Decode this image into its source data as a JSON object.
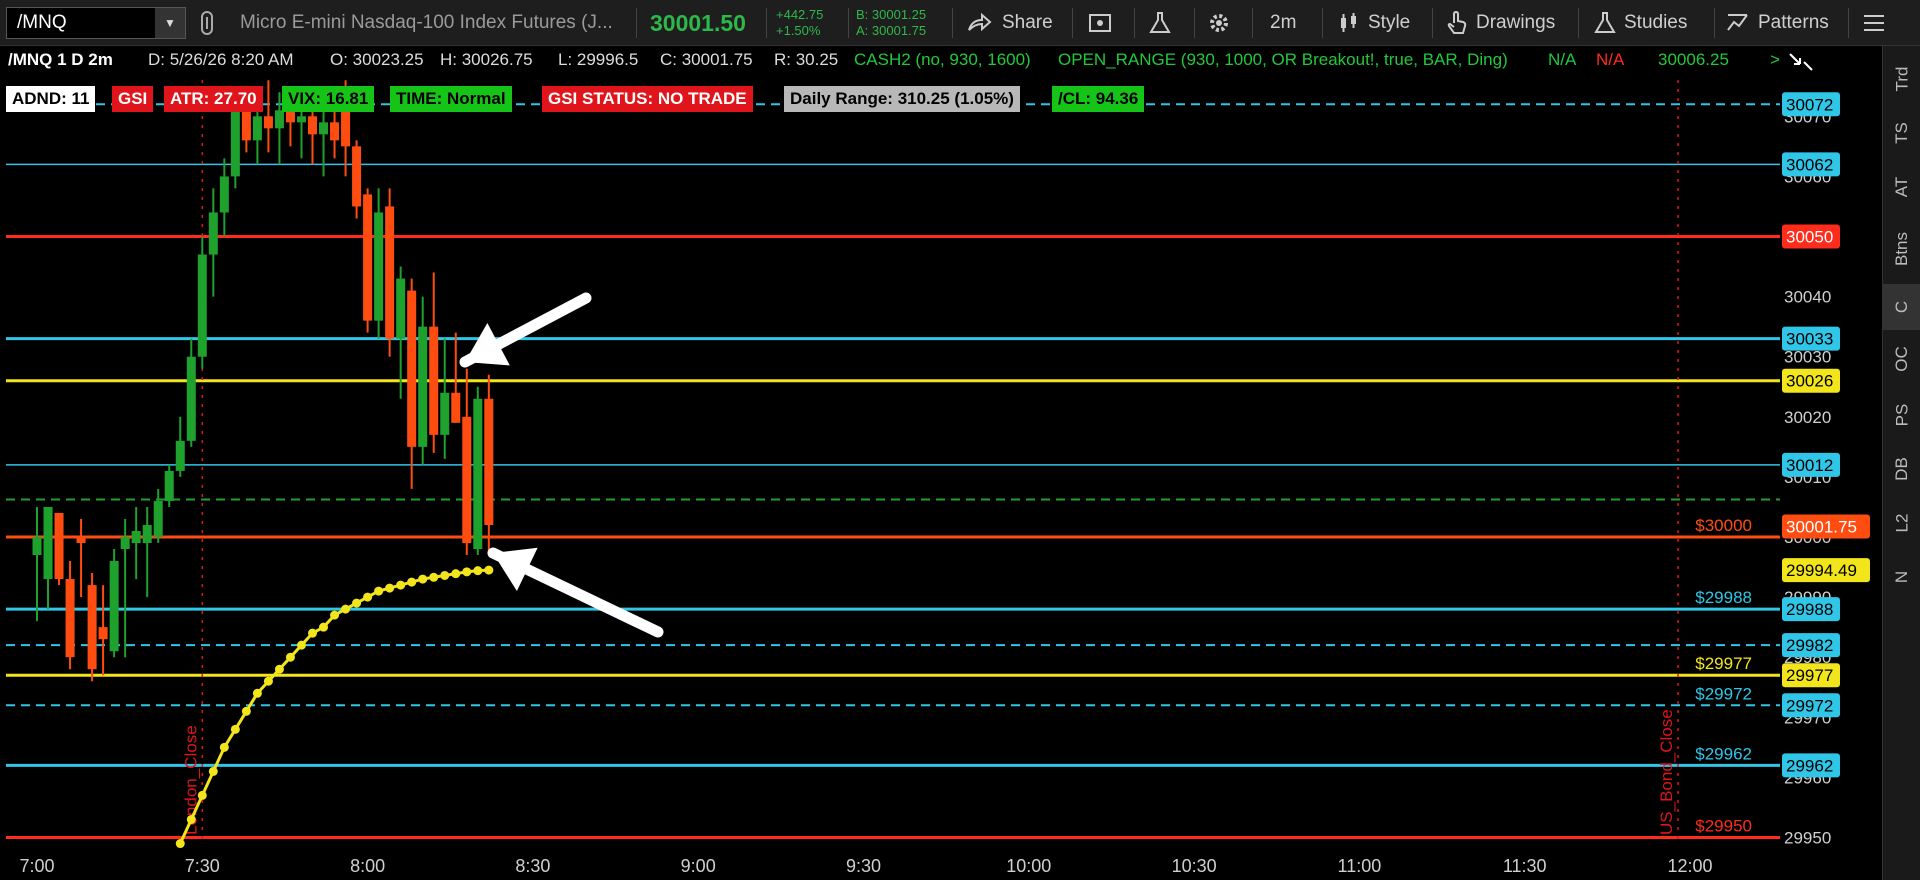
{
  "toolbar": {
    "symbol": "/MNQ",
    "description": "Micro E-mini Nasdaq-100 Index Futures (J...",
    "last_price": "30001.50",
    "net_change": "+442.75",
    "pct_change": "+1.50%",
    "bid": "B: 30001.25",
    "ask": "A: 30001.75",
    "share": "Share",
    "timeframe": "2m",
    "style": "Style",
    "drawings": "Drawings",
    "studies": "Studies",
    "patterns": "Patterns"
  },
  "infobar": {
    "title": "/MNQ 1 D 2m",
    "date": "D: 5/26/26 8:20 AM",
    "open": "O: 30023.25",
    "high": "H: 30026.75",
    "low": "L: 29996.5",
    "close": "C: 30001.75",
    "range": "R: 30.25",
    "cash2": "CASH2 (no, 930, 1600)",
    "open_range": "OPEN_RANGE (930, 1000, OR Breakout!, true, BAR, Ding)",
    "na1": "N/A",
    "na2": "N/A",
    "value": "30006.25"
  },
  "labels": {
    "adnd": "ADND: 11",
    "gsi": "GSI",
    "atr": "ATR: 27.70",
    "vix": "VIX: 16.81",
    "time": "TIME: Normal",
    "gsi_status": "GSI STATUS: NO TRADE",
    "daily_range": "Daily Range: 310.25 (1.05%)",
    "cl": "/CL: 94.36"
  },
  "colors": {
    "up": "#1fa12e",
    "down": "#ff4d12",
    "cyan": "#2fc6e8",
    "red": "#ff2b1b",
    "yellow": "#f2e51c",
    "green": "#1fa12e",
    "orange": "#ff4d12"
  },
  "chart_data": {
    "type": "candlestick",
    "x_axis": [
      "7:00",
      "7:30",
      "8:00",
      "8:30",
      "9:00",
      "9:30",
      "10:00",
      "10:30",
      "11:00",
      "11:30",
      "12:00"
    ],
    "y_axis": [
      "30070",
      "30060",
      "30050",
      "30040",
      "30030",
      "30020",
      "30010",
      "30000",
      "29990",
      "29980",
      "29970",
      "29960",
      "29950"
    ],
    "ylim": [
      29949,
      30076
    ],
    "candles": [
      {
        "t": "7:00",
        "o": 29997,
        "h": 30005,
        "l": 29986,
        "c": 30000
      },
      {
        "t": "7:02",
        "o": 29993,
        "h": 30005,
        "l": 29988,
        "c": 30005
      },
      {
        "t": "7:04",
        "o": 30004,
        "h": 30004,
        "l": 29992,
        "c": 29993
      },
      {
        "t": "7:06",
        "o": 29993,
        "h": 29996,
        "l": 29978,
        "c": 29980
      },
      {
        "t": "7:08",
        "o": 30000,
        "h": 30003,
        "l": 29990,
        "c": 29999
      },
      {
        "t": "7:10",
        "o": 29992,
        "h": 29994,
        "l": 29976,
        "c": 29978
      },
      {
        "t": "7:12",
        "o": 29985,
        "h": 29992,
        "l": 29977,
        "c": 29983
      },
      {
        "t": "7:14",
        "o": 29981,
        "h": 29998,
        "l": 29980,
        "c": 29996
      },
      {
        "t": "7:16",
        "o": 29998,
        "h": 30003,
        "l": 29980,
        "c": 30000
      },
      {
        "t": "7:18",
        "o": 29999,
        "h": 30005,
        "l": 29993,
        "c": 30001
      },
      {
        "t": "7:20",
        "o": 29999,
        "h": 30005,
        "l": 29990,
        "c": 30002
      },
      {
        "t": "7:22",
        "o": 30000,
        "h": 30008,
        "l": 29999,
        "c": 30006
      },
      {
        "t": "7:24",
        "o": 30006,
        "h": 30012,
        "l": 30005,
        "c": 30011
      },
      {
        "t": "7:26",
        "o": 30011,
        "h": 30020,
        "l": 30010,
        "c": 30016
      },
      {
        "t": "7:28",
        "o": 30016,
        "h": 30033,
        "l": 30015,
        "c": 30030
      },
      {
        "t": "7:30",
        "o": 30030,
        "h": 30050,
        "l": 30028,
        "c": 30047
      },
      {
        "t": "7:32",
        "o": 30047,
        "h": 30058,
        "l": 30040,
        "c": 30054
      },
      {
        "t": "7:34",
        "o": 30054,
        "h": 30063,
        "l": 30050,
        "c": 30060
      },
      {
        "t": "7:36",
        "o": 30060,
        "h": 30073,
        "l": 30058,
        "c": 30071
      },
      {
        "t": "7:38",
        "o": 30071,
        "h": 30075,
        "l": 30064,
        "c": 30066
      },
      {
        "t": "7:40",
        "o": 30066,
        "h": 30074,
        "l": 30062,
        "c": 30070
      },
      {
        "t": "7:42",
        "o": 30070,
        "h": 30076,
        "l": 30064,
        "c": 30068
      },
      {
        "t": "7:44",
        "o": 30068,
        "h": 30074,
        "l": 30062,
        "c": 30071
      },
      {
        "t": "7:46",
        "o": 30071,
        "h": 30075,
        "l": 30065,
        "c": 30069
      },
      {
        "t": "7:48",
        "o": 30069,
        "h": 30074,
        "l": 30063,
        "c": 30070
      },
      {
        "t": "7:50",
        "o": 30070,
        "h": 30075,
        "l": 30062,
        "c": 30067
      },
      {
        "t": "7:52",
        "o": 30067,
        "h": 30073,
        "l": 30060,
        "c": 30069
      },
      {
        "t": "7:54",
        "o": 30069,
        "h": 30074,
        "l": 30063,
        "c": 30066
      },
      {
        "t": "7:56",
        "o": 30071,
        "h": 30076,
        "l": 30060,
        "c": 30065
      },
      {
        "t": "7:58",
        "o": 30065,
        "h": 30066,
        "l": 30053,
        "c": 30055
      },
      {
        "t": "8:00",
        "o": 30057,
        "h": 30058,
        "l": 30034,
        "c": 30036
      },
      {
        "t": "8:02",
        "o": 30036,
        "h": 30058,
        "l": 30033,
        "c": 30054
      },
      {
        "t": "8:04",
        "o": 30055,
        "h": 30058,
        "l": 30030,
        "c": 30033
      },
      {
        "t": "8:06",
        "o": 30033,
        "h": 30045,
        "l": 30023,
        "c": 30043
      },
      {
        "t": "8:08",
        "o": 30041,
        "h": 30043,
        "l": 30008,
        "c": 30015
      },
      {
        "t": "8:10",
        "o": 30015,
        "h": 30040,
        "l": 30012,
        "c": 30035
      },
      {
        "t": "8:12",
        "o": 30035,
        "h": 30044,
        "l": 30014,
        "c": 30017
      },
      {
        "t": "8:14",
        "o": 30017,
        "h": 30033,
        "l": 30013,
        "c": 30024
      },
      {
        "t": "8:16",
        "o": 30024,
        "h": 30034,
        "l": 30019,
        "c": 30019
      },
      {
        "t": "8:18",
        "o": 30020,
        "h": 30028,
        "l": 29997,
        "c": 29999
      },
      {
        "t": "8:20",
        "o": 29998,
        "h": 30025,
        "l": 29997,
        "c": 30023
      },
      {
        "t": "8:22",
        "o": 30023,
        "h": 30027,
        "l": 29997,
        "c": 30002
      }
    ],
    "vwap": [
      {
        "t": "7:26",
        "v": 29949
      },
      {
        "t": "7:28",
        "v": 29953
      },
      {
        "t": "7:30",
        "v": 29957
      },
      {
        "t": "7:32",
        "v": 29961
      },
      {
        "t": "7:34",
        "v": 29965
      },
      {
        "t": "7:36",
        "v": 29968
      },
      {
        "t": "7:38",
        "v": 29971
      },
      {
        "t": "7:40",
        "v": 29974
      },
      {
        "t": "7:42",
        "v": 29976
      },
      {
        "t": "7:44",
        "v": 29978
      },
      {
        "t": "7:46",
        "v": 29980
      },
      {
        "t": "7:48",
        "v": 29982
      },
      {
        "t": "7:50",
        "v": 29984
      },
      {
        "t": "7:52",
        "v": 29985
      },
      {
        "t": "7:54",
        "v": 29987
      },
      {
        "t": "7:56",
        "v": 29988
      },
      {
        "t": "7:58",
        "v": 29989
      },
      {
        "t": "8:00",
        "v": 29990
      },
      {
        "t": "8:02",
        "v": 29991
      },
      {
        "t": "8:04",
        "v": 29991.5
      },
      {
        "t": "8:06",
        "v": 29992
      },
      {
        "t": "8:08",
        "v": 29992.5
      },
      {
        "t": "8:10",
        "v": 29993
      },
      {
        "t": "8:12",
        "v": 29993.3
      },
      {
        "t": "8:14",
        "v": 29993.6
      },
      {
        "t": "8:16",
        "v": 29993.9
      },
      {
        "t": "8:18",
        "v": 29994.2
      },
      {
        "t": "8:20",
        "v": 29994.4
      },
      {
        "t": "8:22",
        "v": 29994.49
      }
    ],
    "levels": [
      {
        "price": 30072,
        "color": "cyan",
        "style": "dash",
        "badge": "30072"
      },
      {
        "price": 30062,
        "color": "cyan",
        "style": "thin",
        "badge": "30062"
      },
      {
        "price": 30050,
        "color": "red",
        "style": "solid",
        "badge": "30050"
      },
      {
        "price": 30033,
        "color": "cyan",
        "style": "solid",
        "badge": "30033"
      },
      {
        "price": 30026,
        "color": "yellow",
        "style": "solid",
        "badge": "30026"
      },
      {
        "price": 30012,
        "color": "cyan",
        "style": "thin",
        "badge": "30012"
      },
      {
        "price": 30006.25,
        "color": "green",
        "style": "dash",
        "badge": ""
      },
      {
        "price": 30000,
        "color": "orange",
        "style": "solid",
        "badge": "",
        "label": "$30000"
      },
      {
        "price": 29988,
        "color": "cyan",
        "style": "solid",
        "badge": "29988",
        "label": "$29988"
      },
      {
        "price": 29982,
        "color": "cyan",
        "style": "dash",
        "badge": "29982"
      },
      {
        "price": 29977,
        "color": "yellow",
        "style": "solid",
        "badge": "29977",
        "label": "$29977"
      },
      {
        "price": 29972,
        "color": "cyan",
        "style": "dash",
        "badge": "29972",
        "label": "$29972"
      },
      {
        "price": 29962,
        "color": "cyan",
        "style": "solid",
        "badge": "29962",
        "label": "$29962"
      },
      {
        "price": 29950,
        "color": "red",
        "style": "solid",
        "badge": "",
        "label": "$29950"
      }
    ],
    "last_badge": "30001.75",
    "vwap_badge": "29994.49",
    "vertical_markers": [
      {
        "t": "7:30",
        "label": "London_Close"
      },
      {
        "t": "12:00",
        "label": "US_Bond_Close"
      }
    ]
  },
  "sidebar": [
    "Trd",
    "TS",
    "AT",
    "Btns",
    "C",
    "OC",
    "PS",
    "DB",
    "L2",
    "N"
  ]
}
